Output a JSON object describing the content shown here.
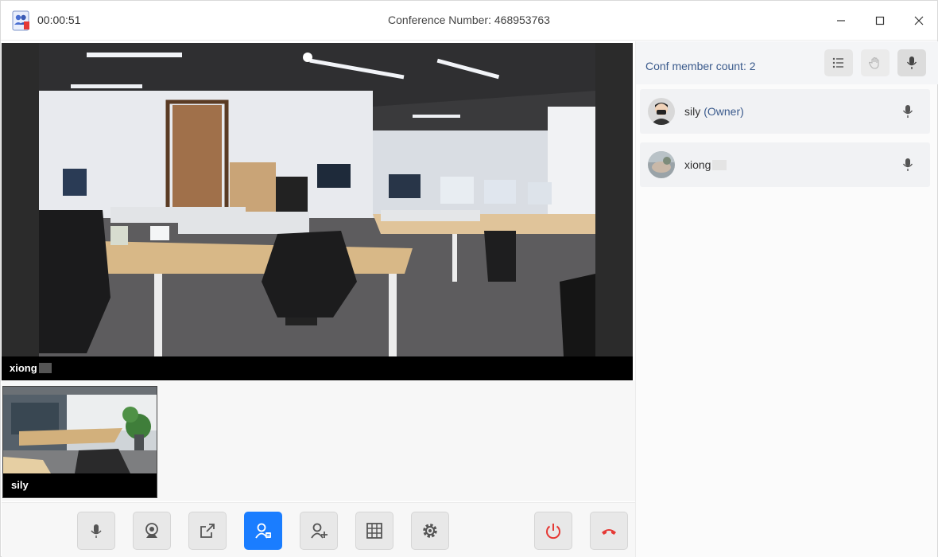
{
  "titlebar": {
    "timer": "00:00:51",
    "conference_label": "Conference Number: 468953763"
  },
  "main_video": {
    "participant_name": "xiong"
  },
  "thumbnail": {
    "participant_name": "sily"
  },
  "toolbar": {
    "buttons": [
      {
        "icon": "microphone-icon"
      },
      {
        "icon": "camera-icon"
      },
      {
        "icon": "share-screen-icon"
      },
      {
        "icon": "participants-icon",
        "active": true
      },
      {
        "icon": "invite-icon"
      },
      {
        "icon": "grid-layout-icon"
      },
      {
        "icon": "settings-icon"
      },
      {
        "icon": "end-conference-icon"
      },
      {
        "icon": "hang-up-icon"
      }
    ],
    "accent_color": "#1a7dff",
    "danger_color": "#e53935"
  },
  "panel": {
    "member_count_label": "Conf member count: 2",
    "members": [
      {
        "name": "sily",
        "role": "(Owner)"
      },
      {
        "name": "xiong",
        "role": ""
      }
    ]
  }
}
